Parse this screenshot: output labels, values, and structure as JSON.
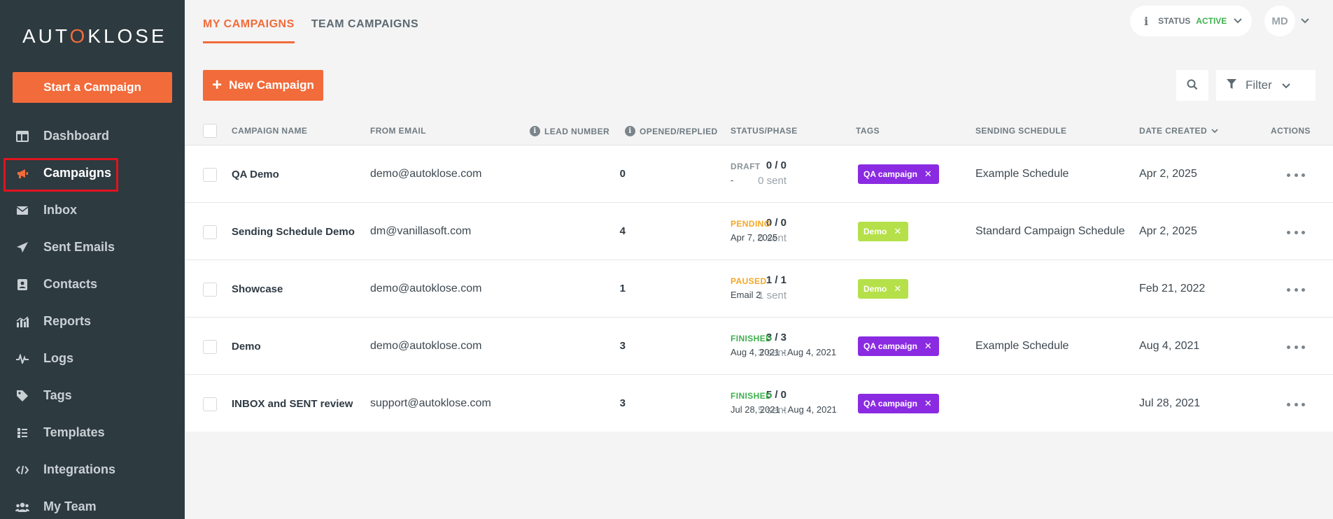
{
  "sidebar": {
    "logo_pre": "AUT",
    "logo_o": "O",
    "logo_post": "KLOSE",
    "start_label": "Start a Campaign",
    "items": [
      {
        "label": "Dashboard",
        "icon": "dashboard-icon"
      },
      {
        "label": "Campaigns",
        "icon": "megaphone-icon"
      },
      {
        "label": "Inbox",
        "icon": "envelope-icon"
      },
      {
        "label": "Sent Emails",
        "icon": "paper-plane-icon"
      },
      {
        "label": "Contacts",
        "icon": "contact-card-icon"
      },
      {
        "label": "Reports",
        "icon": "bar-chart-icon"
      },
      {
        "label": "Logs",
        "icon": "pulse-icon"
      },
      {
        "label": "Tags",
        "icon": "tag-icon"
      },
      {
        "label": "Templates",
        "icon": "templates-icon"
      },
      {
        "label": "Integrations",
        "icon": "code-icon"
      },
      {
        "label": "My Team",
        "icon": "team-icon"
      }
    ]
  },
  "header": {
    "tabs": [
      {
        "label": "MY CAMPAIGNS"
      },
      {
        "label": "TEAM CAMPAIGNS"
      }
    ],
    "status_label": "STATUS",
    "status_value": "ACTIVE",
    "status_color": "#3fb04f",
    "avatar_initials": "MD"
  },
  "toolbar": {
    "new_label": "New Campaign",
    "filter_label": "Filter"
  },
  "table": {
    "columns": {
      "name": "CAMPAIGN NAME",
      "email": "FROM EMAIL",
      "lead": "LEAD NUMBER",
      "opened": "OPENED/REPLIED",
      "status": "STATUS/PHASE",
      "tags": "TAGS",
      "schedule": "SENDING SCHEDULE",
      "date": "DATE CREATED",
      "actions": "ACTIONS"
    },
    "rows": [
      {
        "name": "QA Demo",
        "email": "demo@autoklose.com",
        "lead": "0",
        "opened": "0 / 0",
        "sent": "0 sent",
        "status": "DRAFT",
        "status_color": "#8a949a",
        "phase": "-",
        "tag": "QA campaign",
        "tag_color": "#8a2be2",
        "schedule": "Example Schedule",
        "date": "Apr 2, 2025"
      },
      {
        "name": "Sending Schedule Demo",
        "email": "dm@vanillasoft.com",
        "lead": "4",
        "opened": "0 / 0",
        "sent": "0 sent",
        "status": "PENDING",
        "status_color": "#f5a623",
        "phase": "Apr 7, 2025",
        "tag": "Demo",
        "tag_color": "#b5e04a",
        "schedule": "Standard Campaign Schedule",
        "date": "Apr 2, 2025"
      },
      {
        "name": "Showcase",
        "email": "demo@autoklose.com",
        "lead": "1",
        "opened": "1 / 1",
        "sent": "1 sent",
        "status": "PAUSED",
        "status_color": "#f5a623",
        "phase": "Email 2",
        "tag": "Demo",
        "tag_color": "#b5e04a",
        "schedule": "",
        "date": "Feb 21, 2022"
      },
      {
        "name": "Demo",
        "email": "demo@autoklose.com",
        "lead": "3",
        "opened": "3 / 3",
        "sent": "3 sent",
        "status": "FINISHED",
        "status_color": "#3fb04f",
        "phase": "Aug 4, 2021 - Aug 4, 2021",
        "tag": "QA campaign",
        "tag_color": "#8a2be2",
        "schedule": "Example Schedule",
        "date": "Aug 4, 2021"
      },
      {
        "name": "INBOX and SENT review",
        "email": "support@autoklose.com",
        "lead": "3",
        "opened": "5 / 0",
        "sent": "5 sent",
        "status": "FINISHED",
        "status_color": "#3fb04f",
        "phase": "Jul 28, 2021 - Aug 4, 2021",
        "tag": "QA campaign",
        "tag_color": "#8a2be2",
        "schedule": "",
        "date": "Jul 28, 2021"
      }
    ]
  }
}
